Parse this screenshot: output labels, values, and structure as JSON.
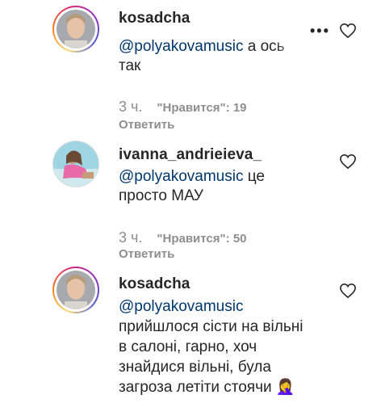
{
  "comments": [
    {
      "username": "kosadcha",
      "mention": "@polyakovamusic",
      "text_line1_tail": " а ось",
      "text_line2": "так",
      "time": "3 ч.",
      "likes_label": "\"Нравится\":",
      "likes_count": "19",
      "reply_label": "Ответить",
      "more_icon": "•••"
    },
    {
      "username": "ivanna_andrieieva_",
      "mention": "@polyakovamusic",
      "text_line1_tail": " це",
      "text_line2": "просто МАУ",
      "time": "3 ч.",
      "likes_label": "\"Нравится\":",
      "likes_count": "50",
      "reply_label": "Ответить"
    },
    {
      "username": "kosadcha",
      "mention": "@polyakovamusic",
      "text_line2": "прийшлося сісти на вільні",
      "text_line3": "в салоні, гарно, хоч",
      "text_line4": "знайдися вільні, була",
      "text_line5": "загроза летіти стоячи 🤦‍♀️"
    }
  ],
  "colors": {
    "text": "#262626",
    "mention": "#00376b",
    "meta": "#8e8e8e"
  }
}
